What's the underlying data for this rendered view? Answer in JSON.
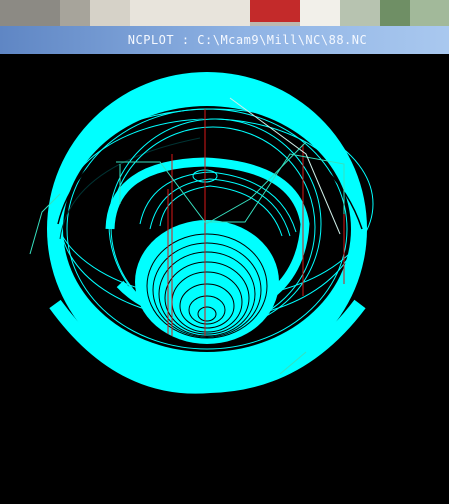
{
  "window": {
    "title": "NCPLOT : C:\\Mcam9\\Mill\\NC\\88.NC"
  },
  "plot": {
    "toolpath_color": "#00ffff",
    "axis_color": "#d81818",
    "guide_color": "#36e0c0",
    "background_color": "#000000"
  }
}
